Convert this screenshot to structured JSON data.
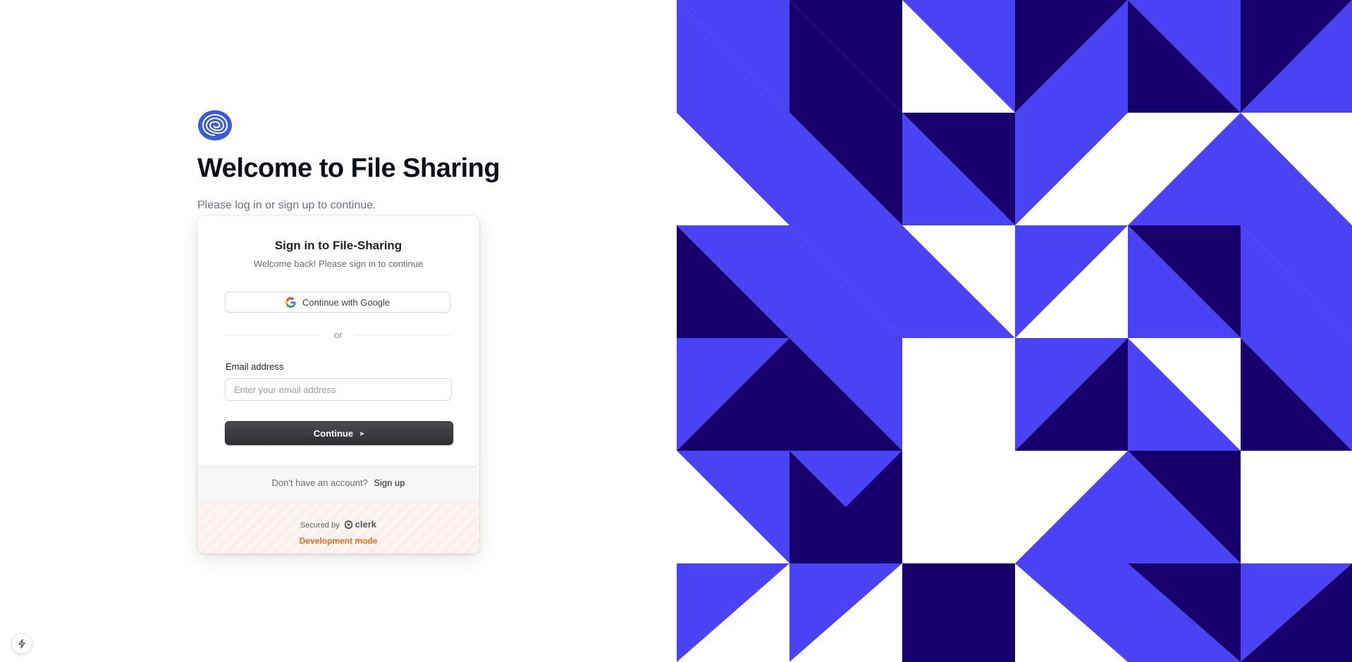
{
  "page": {
    "heading": "Welcome to File Sharing",
    "subtext": "Please log in or sign up to continue."
  },
  "card": {
    "title": "Sign in to File-Sharing",
    "subtitle": "Welcome back! Please sign in to continue",
    "google_button_label": "Continue with Google",
    "divider_text": "or",
    "email_label": "Email address",
    "email_placeholder": "Enter your email address",
    "email_value": "",
    "continue_label": "Continue",
    "no_account_text": "Don't have an account?",
    "signup_link": "Sign up",
    "secured_by": "Secured by",
    "provider_name": "clerk",
    "dev_mode": "Development mode"
  },
  "colors": {
    "accent": "#4a42f5",
    "dark_accent": "#16006b",
    "logo": "#3b5bdb",
    "dev_mode": "#f36b16"
  },
  "icons": [
    "spiral-logo-icon",
    "google-icon",
    "play-caret-icon",
    "clerk-icon",
    "bolt-icon"
  ]
}
